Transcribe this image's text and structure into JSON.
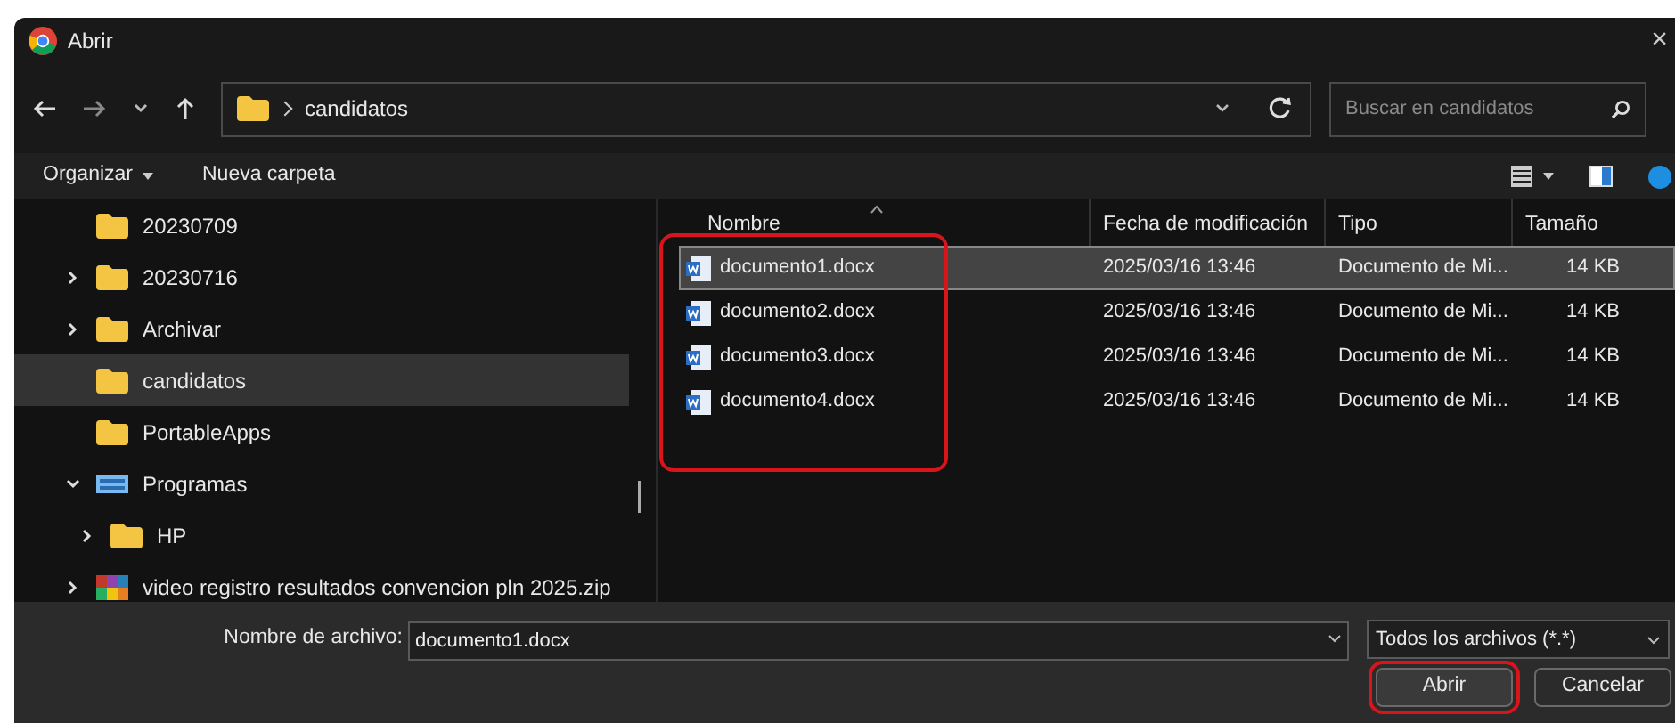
{
  "window": {
    "title": "Abrir",
    "close": "×"
  },
  "address": {
    "path": "candidatos",
    "search_placeholder": "Buscar en candidatos"
  },
  "toolbar": {
    "organize": "Organizar",
    "new_folder": "Nueva carpeta"
  },
  "sidebar": {
    "items": [
      {
        "label": "20230709",
        "kind": "folder",
        "selected": false
      },
      {
        "label": "20230716",
        "kind": "folder",
        "selected": false,
        "expanded": false
      },
      {
        "label": "Archivar",
        "kind": "folder",
        "selected": false,
        "expanded": false
      },
      {
        "label": "candidatos",
        "kind": "folder",
        "selected": true
      },
      {
        "label": "PortableApps",
        "kind": "folder",
        "selected": false
      },
      {
        "label": "Programas",
        "kind": "drive",
        "selected": false,
        "expanded": true,
        "children": [
          {
            "label": "HP",
            "kind": "folder",
            "selected": false,
            "expanded": false
          }
        ]
      },
      {
        "label": "video registro resultados convencion pln 2025.zip",
        "kind": "archive",
        "selected": false,
        "expanded": false
      }
    ]
  },
  "table": {
    "columns": [
      "Nombre",
      "Fecha de modificación",
      "Tipo",
      "Tamaño"
    ],
    "rows": [
      {
        "cells": [
          "documento1.docx",
          "2025/03/16 13:46",
          "Documento de Mi...",
          "14 KB"
        ],
        "selected": true
      },
      {
        "cells": [
          "documento2.docx",
          "2025/03/16 13:46",
          "Documento de Mi...",
          "14 KB"
        ],
        "selected": false
      },
      {
        "cells": [
          "documento3.docx",
          "2025/03/16 13:46",
          "Documento de Mi...",
          "14 KB"
        ],
        "selected": false
      },
      {
        "cells": [
          "documento4.docx",
          "2025/03/16 13:46",
          "Documento de Mi...",
          "14 KB"
        ],
        "selected": false
      }
    ]
  },
  "footer": {
    "filename_label": "Nombre de archivo:",
    "filename": "documento1.docx",
    "filter": "Todos los archivos (*.*)",
    "buttons": [
      "Abrir",
      "Cancelar"
    ]
  }
}
